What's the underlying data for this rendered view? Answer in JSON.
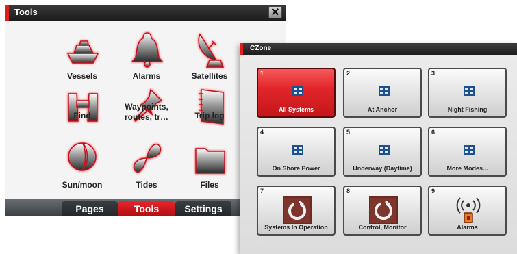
{
  "tools_window": {
    "title": "Tools",
    "close_label": "✕",
    "items": [
      {
        "label": "Vessels",
        "icon": "vessel-icon"
      },
      {
        "label": "Alarms",
        "icon": "bell-icon"
      },
      {
        "label": "Satellites",
        "icon": "satellite-dish-icon"
      },
      {
        "label": "Find",
        "icon": "binoculars-icon"
      },
      {
        "label": "Waypoints,",
        "label2": "routes, tr…",
        "icon": "pushpin-icon"
      },
      {
        "label": "Trip log",
        "icon": "notebook-icon"
      },
      {
        "label": "Sun/moon",
        "icon": "sun-moon-icon"
      },
      {
        "label": "Tides",
        "icon": "tide-wave-icon"
      },
      {
        "label": "Files",
        "icon": "folder-icon"
      }
    ],
    "tabs": [
      {
        "label": "Pages",
        "active": false
      },
      {
        "label": "Tools",
        "active": true
      },
      {
        "label": "Settings",
        "active": false
      }
    ]
  },
  "czone_window": {
    "title": "CZone",
    "modes": [
      {
        "number": "1",
        "label": "All Systems",
        "active": true,
        "icon": "grid-icon"
      },
      {
        "number": "2",
        "label": "At Anchor",
        "active": false,
        "icon": "grid-icon"
      },
      {
        "number": "3",
        "label": "Night Fishing",
        "active": false,
        "icon": "grid-icon"
      },
      {
        "number": "4",
        "label": "On Shore Power",
        "active": false,
        "icon": "grid-icon"
      },
      {
        "number": "5",
        "label": "Underway (Daytime)",
        "active": false,
        "icon": "grid-icon"
      },
      {
        "number": "6",
        "label": "More Modes...",
        "active": false,
        "icon": "grid-icon"
      },
      {
        "number": "7",
        "label": "Systems In Operation",
        "active": false,
        "icon": "power-icon"
      },
      {
        "number": "8",
        "label": "Control, Monitor",
        "active": false,
        "icon": "power-icon"
      },
      {
        "number": "9",
        "label": "Alarms",
        "active": false,
        "icon": "alarm-sensor-icon"
      }
    ]
  },
  "colors": {
    "accent_red": "#e01e1e",
    "icon_glow": "#d8101a",
    "titlebar": "#2a2a2a"
  }
}
